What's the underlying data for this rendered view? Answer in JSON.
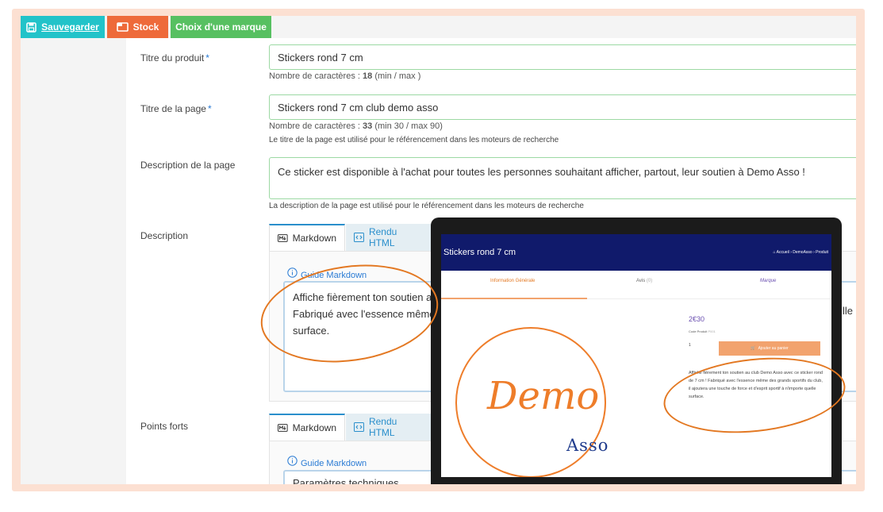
{
  "toolbar": {
    "save_label": "Sauvegarder",
    "stock_label": "Stock",
    "brand_label": "Choix d'une marque"
  },
  "fields": {
    "product_title": {
      "label": "Titre du produit",
      "required_mark": "*",
      "value": "Stickers rond 7 cm",
      "count_prefix": "Nombre de caractères :",
      "count_value": "18",
      "count_suffix": "(min / max )"
    },
    "page_title": {
      "label": "Titre de la page",
      "required_mark": "*",
      "value": "Stickers rond 7 cm club demo asso",
      "count_prefix": "Nombre de caractères :",
      "count_value": "33",
      "count_suffix": "(min 30 / max 90)",
      "seo_help": "Le titre de la page est utilisé pour le référencement dans les moteurs de recherche"
    },
    "page_description": {
      "label": "Description de la page",
      "value": "Ce sticker est disponible à l'achat pour toutes les personnes souhaitant afficher, partout, leur soutien à Demo Asso !",
      "seo_help": "La description de la page est utilisé pour le référencement dans les moteurs de recherche"
    },
    "description": {
      "label": "Description",
      "tab_markdown": "Markdown",
      "tab_html": "Rendu HTML",
      "guide": "Guide Markdown",
      "line1": "Affiche fièrement ton soutien a",
      "line2": "Fabriqué avec l'essence même",
      "line3": "surface.",
      "overflow_fragment": "lle"
    },
    "highlights": {
      "label": "Points forts",
      "tab_markdown": "Markdown",
      "tab_html": "Rendu HTML",
      "guide": "Guide Markdown",
      "partial_text": "Paramètres techniques"
    }
  },
  "preview": {
    "title": "Stickers rond 7 cm",
    "breadcrumb_home": "Accueil",
    "breadcrumb_shop": "DemoAsso",
    "breadcrumb_tail": "Produit",
    "tab_general": "Information Générale",
    "tab_reviews": "Avis",
    "tab_reviews_count": "(0)",
    "tab_brand": "Marque",
    "price": "2€30",
    "code_label": "Code Produit",
    "code_value": "P001",
    "quantity": "1",
    "cart_button": "Ajouter au panier",
    "description": "Affiche fièrement ton soutien au club Demo Asso avec ce sticker rond de 7 cm ! Fabriqué avec l'essence même des grands sportifs du club, il ajoutera une touche de force et d'esprit sportif à n'importe quelle surface.",
    "logo_word1": "Demo",
    "logo_word2": "Asso"
  },
  "colors": {
    "save": "#22c3c9",
    "stock": "#ee6a3a",
    "brand": "#57c061",
    "accent_blue": "#2a7bd4",
    "annotation_orange": "#e37822",
    "preview_header": "#101a6b"
  }
}
